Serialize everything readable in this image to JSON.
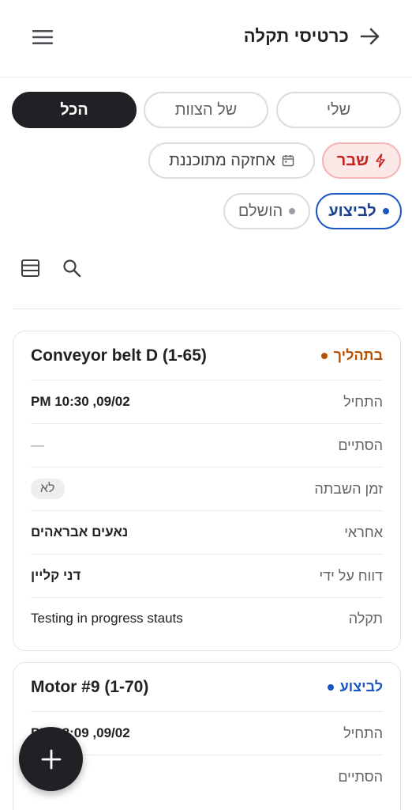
{
  "header": {
    "title": "כרטיסי תקלה",
    "back_icon": "arrow-forward-icon",
    "menu_icon": "hamburger-menu-icon"
  },
  "filters": {
    "scope": [
      {
        "label": "שלי",
        "active": false
      },
      {
        "label": "של הצוות",
        "active": false
      },
      {
        "label": "הכל",
        "active": true
      }
    ],
    "type": [
      {
        "label": "שבר",
        "icon": "lightning-icon",
        "active": true
      },
      {
        "label": "אחזקה מתוכננת",
        "icon": "calendar-icon",
        "active": false
      }
    ],
    "status": [
      {
        "label": "לביצוע",
        "active": true,
        "dot_color": "#1a56c4"
      },
      {
        "label": "הושלם",
        "active": false,
        "dot_color": "#9aa0a6"
      }
    ]
  },
  "tools": {
    "list_icon": "table-view-icon",
    "search_icon": "search-icon"
  },
  "cards": [
    {
      "title": "Conveyor belt D (1-65)",
      "status": {
        "label": "בתהליך",
        "color": "#b95000"
      },
      "rows": [
        {
          "label": "התחיל",
          "value": "PM 10:30 ,09/02"
        },
        {
          "label": "הסתיים",
          "value": "—"
        },
        {
          "label": "זמן השבתה",
          "value": "לא"
        },
        {
          "label": "אחראי",
          "value": "נאעים אבראהים"
        },
        {
          "label": "דווח על ידי",
          "value": "דני קליין"
        },
        {
          "label": "תקלה",
          "value": "Testing in progress stauts"
        }
      ]
    },
    {
      "title": "Motor #9 (1-70)",
      "status": {
        "label": "לביצוע",
        "color": "#1a56c4"
      },
      "rows": [
        {
          "label": "התחיל",
          "value": "PM 08:09 ,09/02"
        },
        {
          "label": "הסתיים",
          "value": ""
        }
      ]
    }
  ],
  "fab": {
    "icon": "plus-icon"
  },
  "colors": {
    "accent": "#202124",
    "danger": "#c5221f",
    "primary": "#1a56c4",
    "in_progress": "#b95000"
  }
}
